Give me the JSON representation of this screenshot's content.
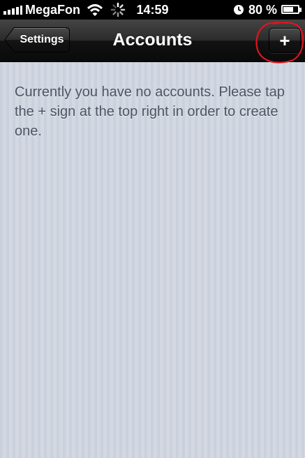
{
  "status_bar": {
    "carrier": "MegaFon",
    "time": "14:59",
    "battery_percent": "80 %",
    "battery_level": 0.8,
    "icons": [
      "signal-icon",
      "wifi-icon",
      "activity-spinner-icon",
      "alarm-icon",
      "battery-icon"
    ]
  },
  "nav_bar": {
    "back_label": "Settings",
    "title": "Accounts",
    "add_label": "+",
    "highlight_color": "#e0141e"
  },
  "content": {
    "message": "Currently you have no accounts. Please tap the + sign at the top right in order to create one."
  }
}
